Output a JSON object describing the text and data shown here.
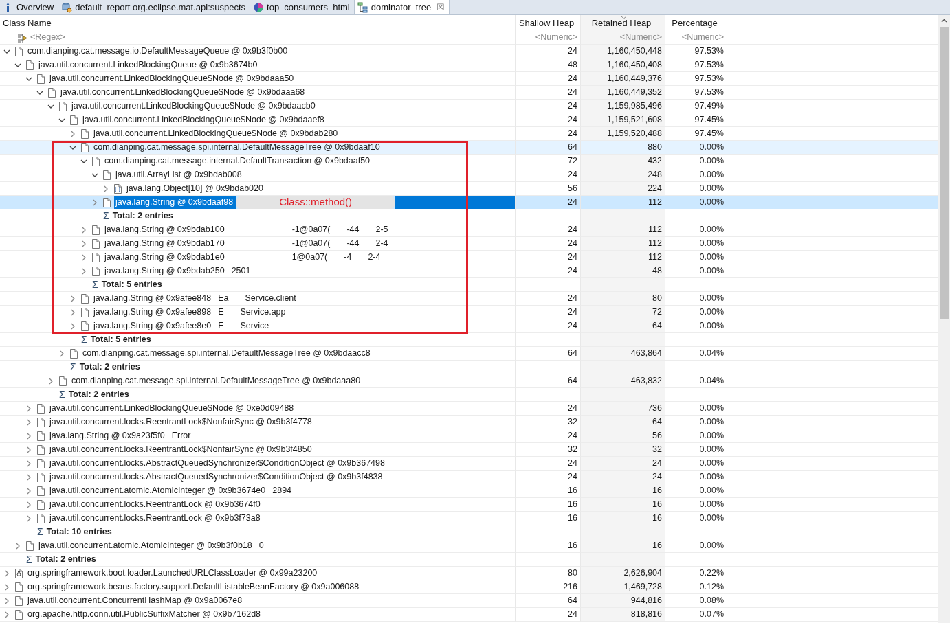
{
  "tabs": [
    {
      "label": "Overview",
      "kind": "info",
      "selected": false,
      "closable": false
    },
    {
      "label": "default_report  org.eclipse.mat.api:suspects",
      "kind": "report",
      "selected": false,
      "closable": false
    },
    {
      "label": "top_consumers_html",
      "kind": "chart",
      "selected": false,
      "closable": false
    },
    {
      "label": "dominator_tree",
      "kind": "tree",
      "selected": true,
      "closable": true
    }
  ],
  "close_glyph": "☒",
  "columns": [
    {
      "label": "Class Name",
      "filter": "<Regex>",
      "sorted": false
    },
    {
      "label": "Shallow Heap",
      "filter": "<Numeric>",
      "sorted": false
    },
    {
      "label": "Retained Heap",
      "filter": "<Numeric>",
      "sorted": true
    },
    {
      "label": "Percentage",
      "filter": "<Numeric>",
      "sorted": false
    }
  ],
  "rows": [
    {
      "kind": "object",
      "label": "com.dianping.cat.message.io.DefaultMessageQueue @ 0x9b3f0b00",
      "shallow": "24",
      "retained": "1,160,450,448",
      "percentage": "97.53%",
      "expanded": true,
      "selected": false,
      "hovered": false,
      "children": [
        {
          "kind": "object",
          "label": "java.util.concurrent.LinkedBlockingQueue @ 0x9b3674b0",
          "shallow": "48",
          "retained": "1,160,450,408",
          "percentage": "97.53%",
          "expanded": true,
          "selected": false,
          "hovered": false,
          "children": [
            {
              "kind": "object",
              "label": "java.util.concurrent.LinkedBlockingQueue$Node @ 0x9bdaaa50",
              "shallow": "24",
              "retained": "1,160,449,376",
              "percentage": "97.53%",
              "expanded": true,
              "selected": false,
              "hovered": false,
              "children": [
                {
                  "kind": "object",
                  "label": "java.util.concurrent.LinkedBlockingQueue$Node @ 0x9bdaaa68",
                  "shallow": "24",
                  "retained": "1,160,449,352",
                  "percentage": "97.53%",
                  "expanded": true,
                  "selected": false,
                  "hovered": false,
                  "children": [
                    {
                      "kind": "object",
                      "label": "java.util.concurrent.LinkedBlockingQueue$Node @ 0x9bdaacb0",
                      "shallow": "24",
                      "retained": "1,159,985,496",
                      "percentage": "97.49%",
                      "expanded": true,
                      "selected": false,
                      "hovered": false,
                      "children": [
                        {
                          "kind": "object",
                          "label": "java.util.concurrent.LinkedBlockingQueue$Node @ 0x9bdaaef8",
                          "shallow": "24",
                          "retained": "1,159,521,608",
                          "percentage": "97.45%",
                          "expanded": true,
                          "selected": false,
                          "hovered": false,
                          "children": [
                            {
                              "kind": "object",
                              "label": "java.util.concurrent.LinkedBlockingQueue$Node @ 0x9bdab280",
                              "shallow": "24",
                              "retained": "1,159,520,488",
                              "percentage": "97.45%",
                              "expanded": false,
                              "selected": false,
                              "hovered": false
                            },
                            {
                              "kind": "object",
                              "label": "com.dianping.cat.message.spi.internal.DefaultMessageTree @ 0x9bdaaf10",
                              "shallow": "64",
                              "retained": "880",
                              "percentage": "0.00%",
                              "expanded": true,
                              "selected": false,
                              "hovered": true,
                              "children": [
                                {
                                  "kind": "object",
                                  "label": "com.dianping.cat.message.internal.DefaultTransaction @ 0x9bdaaf50",
                                  "shallow": "72",
                                  "retained": "432",
                                  "percentage": "0.00%",
                                  "expanded": true,
                                  "selected": false,
                                  "hovered": false,
                                  "children": [
                                    {
                                      "kind": "object",
                                      "label": "java.util.ArrayList @ 0x9bdab008",
                                      "shallow": "24",
                                      "retained": "248",
                                      "percentage": "0.00%",
                                      "expanded": true,
                                      "selected": false,
                                      "hovered": false,
                                      "children": [
                                        {
                                          "kind": "array",
                                          "label": "java.lang.Object[10] @ 0x9bdab020",
                                          "shallow": "56",
                                          "retained": "224",
                                          "percentage": "0.00%",
                                          "expanded": false,
                                          "selected": false,
                                          "hovered": false
                                        }
                                      ]
                                    },
                                    {
                                      "kind": "object",
                                      "label": "java.lang.String @ 0x9bdaaf98",
                                      "shallow": "24",
                                      "retained": "112",
                                      "percentage": "0.00%",
                                      "expanded": false,
                                      "selected": true,
                                      "hovered": false,
                                      "note": "Class::method()"
                                    },
                                    {
                                      "kind": "total",
                                      "symbol": "Σ",
                                      "label": "Total: 2 entries"
                                    }
                                  ]
                                },
                                {
                                  "kind": "object",
                                  "label": "java.lang.String @ 0x9bdab100",
                                  "fragments": [
                                    "-1@0a07(",
                                    "-44",
                                    "2-5"
                                  ],
                                  "shallow": "24",
                                  "retained": "112",
                                  "percentage": "0.00%",
                                  "expanded": false,
                                  "selected": false,
                                  "hovered": false
                                },
                                {
                                  "kind": "object",
                                  "label": "java.lang.String @ 0x9bdab170",
                                  "fragments": [
                                    "-1@0a07(",
                                    "-44",
                                    "2-4"
                                  ],
                                  "shallow": "24",
                                  "retained": "112",
                                  "percentage": "0.00%",
                                  "expanded": false,
                                  "selected": false,
                                  "hovered": false
                                },
                                {
                                  "kind": "object",
                                  "label": "java.lang.String @ 0x9bdab1e0",
                                  "fragments": [
                                    "1@0a07(",
                                    "-4",
                                    "2-4"
                                  ],
                                  "shallow": "24",
                                  "retained": "112",
                                  "percentage": "0.00%",
                                  "expanded": false,
                                  "selected": false,
                                  "hovered": false
                                },
                                {
                                  "kind": "object",
                                  "label": "java.lang.String @ 0x9bdab250",
                                  "fragments": [
                                    "2501"
                                  ],
                                  "shallow": "24",
                                  "retained": "48",
                                  "percentage": "0.00%",
                                  "expanded": false,
                                  "selected": false,
                                  "hovered": false
                                },
                                {
                                  "kind": "total",
                                  "symbol": "Σ",
                                  "label": "Total: 5 entries"
                                }
                              ]
                            },
                            {
                              "kind": "object",
                              "label": "java.lang.String @ 0x9afee848",
                              "fragments": [
                                "Ea",
                                "Service.client"
                              ],
                              "shallow": "24",
                              "retained": "80",
                              "percentage": "0.00%",
                              "expanded": false,
                              "selected": false,
                              "hovered": false
                            },
                            {
                              "kind": "object",
                              "label": "java.lang.String @ 0x9afee898",
                              "fragments": [
                                "E",
                                "Service.app"
                              ],
                              "shallow": "24",
                              "retained": "72",
                              "percentage": "0.00%",
                              "expanded": false,
                              "selected": false,
                              "hovered": false
                            },
                            {
                              "kind": "object",
                              "label": "java.lang.String @ 0x9afee8e0",
                              "fragments": [
                                "E",
                                "Service"
                              ],
                              "shallow": "24",
                              "retained": "64",
                              "percentage": "0.00%",
                              "expanded": false,
                              "selected": false,
                              "hovered": false
                            },
                            {
                              "kind": "total",
                              "symbol": "Σ",
                              "label": "Total: 5 entries"
                            }
                          ]
                        },
                        {
                          "kind": "object",
                          "label": "com.dianping.cat.message.spi.internal.DefaultMessageTree @ 0x9bdaacc8",
                          "shallow": "64",
                          "retained": "463,864",
                          "percentage": "0.04%",
                          "expanded": false,
                          "selected": false,
                          "hovered": false
                        },
                        {
                          "kind": "total",
                          "symbol": "Σ",
                          "label": "Total: 2 entries"
                        }
                      ]
                    },
                    {
                      "kind": "object",
                      "label": "com.dianping.cat.message.spi.internal.DefaultMessageTree @ 0x9bdaaa80",
                      "shallow": "64",
                      "retained": "463,832",
                      "percentage": "0.04%",
                      "expanded": false,
                      "selected": false,
                      "hovered": false
                    },
                    {
                      "kind": "total",
                      "symbol": "Σ",
                      "label": "Total: 2 entries"
                    }
                  ]
                }
              ]
            },
            {
              "kind": "object",
              "label": "java.util.concurrent.LinkedBlockingQueue$Node @ 0xe0d09488",
              "shallow": "24",
              "retained": "736",
              "percentage": "0.00%",
              "expanded": false,
              "selected": false,
              "hovered": false
            },
            {
              "kind": "object",
              "label": "java.util.concurrent.locks.ReentrantLock$NonfairSync @ 0x9b3f4778",
              "shallow": "32",
              "retained": "64",
              "percentage": "0.00%",
              "expanded": false,
              "selected": false,
              "hovered": false
            },
            {
              "kind": "object",
              "label": "java.lang.String @ 0x9a23f5f0",
              "fragments": [
                "Error"
              ],
              "shallow": "24",
              "retained": "56",
              "percentage": "0.00%",
              "expanded": false,
              "selected": false,
              "hovered": false
            },
            {
              "kind": "object",
              "label": "java.util.concurrent.locks.ReentrantLock$NonfairSync @ 0x9b3f4850",
              "shallow": "32",
              "retained": "32",
              "percentage": "0.00%",
              "expanded": false,
              "selected": false,
              "hovered": false
            },
            {
              "kind": "object",
              "label": "java.util.concurrent.locks.AbstractQueuedSynchronizer$ConditionObject @ 0x9b367498",
              "shallow": "24",
              "retained": "24",
              "percentage": "0.00%",
              "expanded": false,
              "selected": false,
              "hovered": false
            },
            {
              "kind": "object",
              "label": "java.util.concurrent.locks.AbstractQueuedSynchronizer$ConditionObject @ 0x9b3f4838",
              "shallow": "24",
              "retained": "24",
              "percentage": "0.00%",
              "expanded": false,
              "selected": false,
              "hovered": false
            },
            {
              "kind": "object",
              "label": "java.util.concurrent.atomic.AtomicInteger @ 0x9b3674e0",
              "fragments": [
                "2894"
              ],
              "shallow": "16",
              "retained": "16",
              "percentage": "0.00%",
              "expanded": false,
              "selected": false,
              "hovered": false
            },
            {
              "kind": "object",
              "label": "java.util.concurrent.locks.ReentrantLock @ 0x9b3674f0",
              "shallow": "16",
              "retained": "16",
              "percentage": "0.00%",
              "expanded": false,
              "selected": false,
              "hovered": false
            },
            {
              "kind": "object",
              "label": "java.util.concurrent.locks.ReentrantLock @ 0x9b3f73a8",
              "shallow": "16",
              "retained": "16",
              "percentage": "0.00%",
              "expanded": false,
              "selected": false,
              "hovered": false
            },
            {
              "kind": "total",
              "symbol": "Σ",
              "label": "Total: 10 entries"
            }
          ]
        },
        {
          "kind": "object",
          "label": "java.util.concurrent.atomic.AtomicInteger @ 0x9b3f0b18",
          "fragments": [
            "0"
          ],
          "shallow": "16",
          "retained": "16",
          "percentage": "0.00%",
          "expanded": false,
          "selected": false,
          "hovered": false
        },
        {
          "kind": "total",
          "symbol": "Σ",
          "label": "Total: 2 entries"
        }
      ]
    },
    {
      "kind": "classloader",
      "label": "org.springframework.boot.loader.LaunchedURLClassLoader @ 0x99a23200",
      "shallow": "80",
      "retained": "2,626,904",
      "percentage": "0.22%",
      "expanded": false,
      "selected": false,
      "hovered": false
    },
    {
      "kind": "object",
      "label": "org.springframework.beans.factory.support.DefaultListableBeanFactory @ 0x9a006088",
      "shallow": "216",
      "retained": "1,469,728",
      "percentage": "0.12%",
      "expanded": false,
      "selected": false,
      "hovered": false
    },
    {
      "kind": "object",
      "label": "java.util.concurrent.ConcurrentHashMap @ 0x9a0067e8",
      "shallow": "64",
      "retained": "944,816",
      "percentage": "0.08%",
      "expanded": false,
      "selected": false,
      "hovered": false
    },
    {
      "kind": "object",
      "label": "org.apache.http.conn.util.PublicSuffixMatcher @ 0x9b7162d8",
      "shallow": "24",
      "retained": "818,816",
      "percentage": "0.07%",
      "expanded": false,
      "selected": false,
      "hovered": false
    }
  ]
}
